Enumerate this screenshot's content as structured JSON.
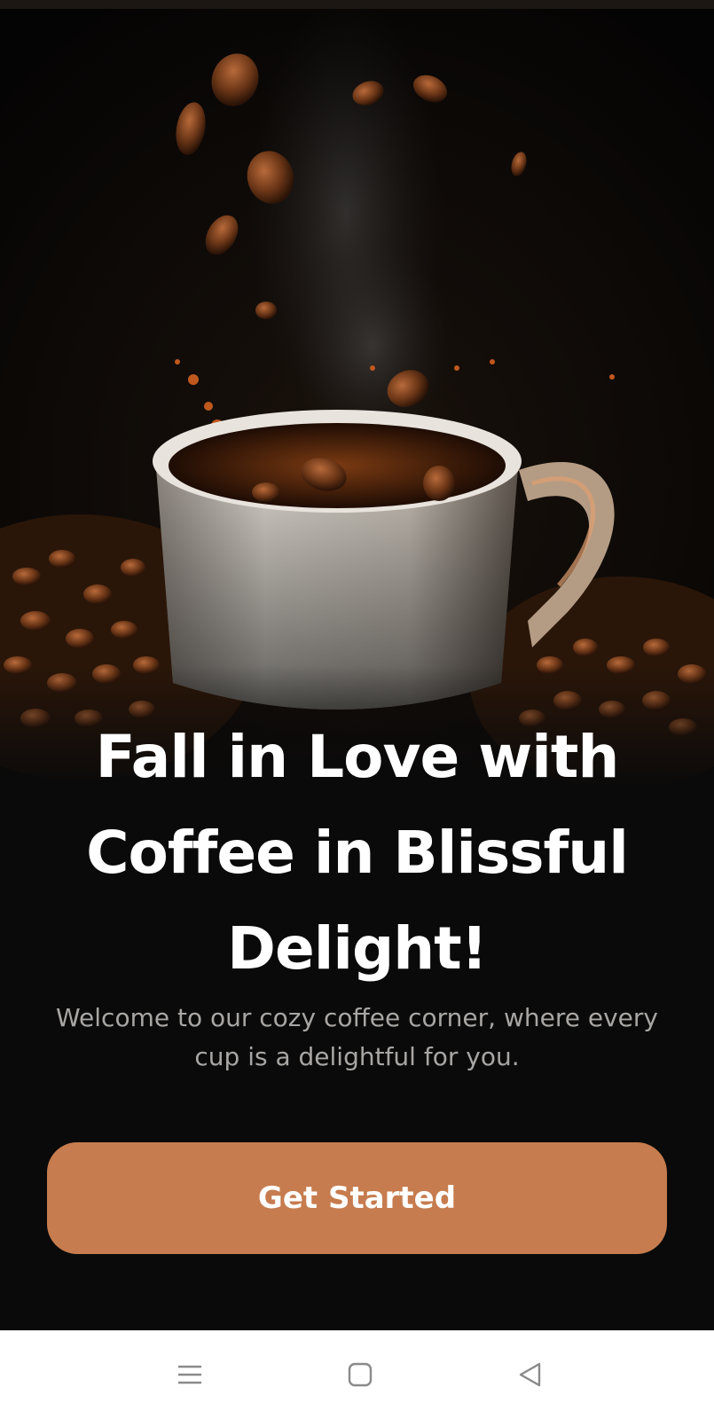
{
  "onboarding": {
    "hero_image": "coffee-cup-with-falling-beans-photo",
    "headline": "Fall in Love with Coffee in Blissful Delight!",
    "subtitle": "Welcome to our cozy coffee corner, where every cup is a delightful for you.",
    "cta_label": "Get Started",
    "accent_color": "#C67C4E"
  },
  "system_nav": {
    "buttons": [
      {
        "name": "recent-apps",
        "icon": "menu-lines-icon"
      },
      {
        "name": "home",
        "icon": "rounded-square-icon"
      },
      {
        "name": "back",
        "icon": "triangle-back-icon"
      }
    ]
  }
}
